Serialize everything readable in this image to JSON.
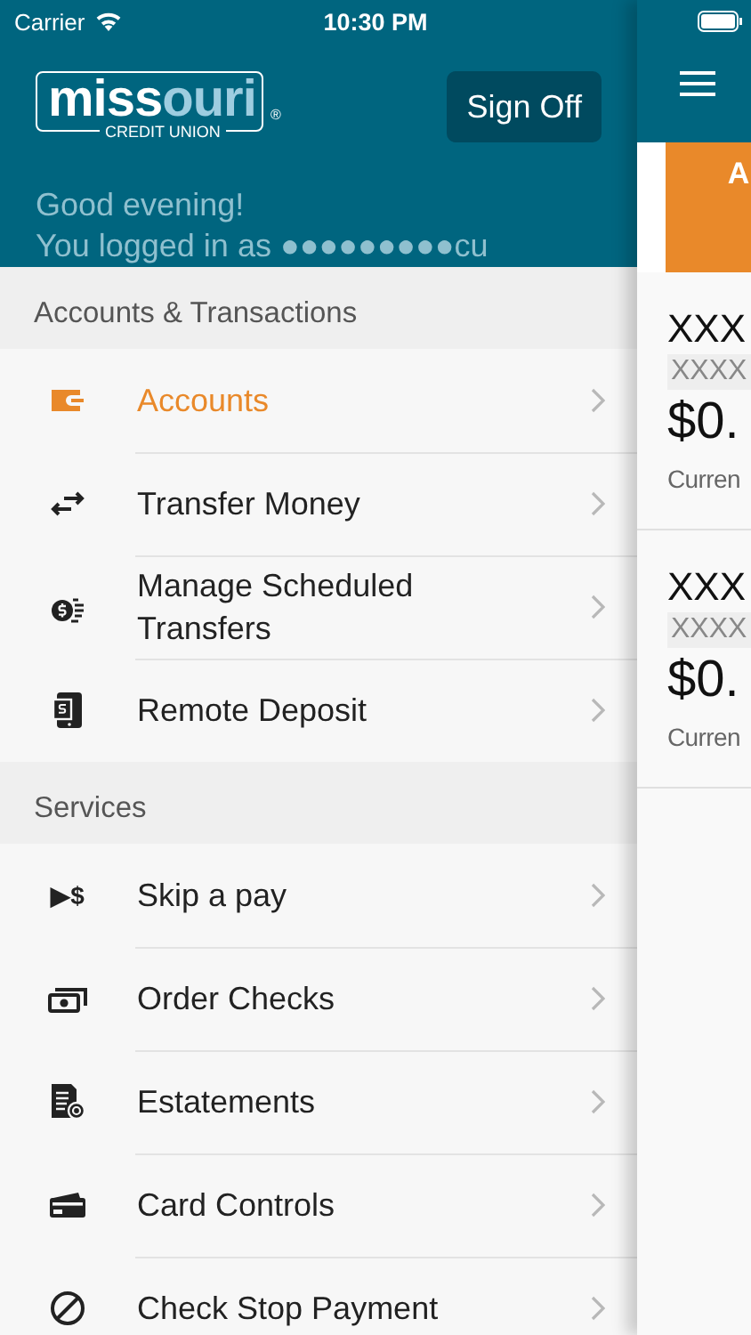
{
  "status_bar": {
    "carrier": "Carrier",
    "time": "10:30 PM"
  },
  "header": {
    "logo": {
      "main": "miss",
      "accent": "ouri",
      "subtitle": "CREDIT UNION",
      "mark": "®"
    },
    "sign_off": "Sign Off",
    "greeting": "Good evening!",
    "login": "You logged in as ●●●●●●●●●cu"
  },
  "sections": [
    {
      "title": "Accounts & Transactions",
      "items": [
        {
          "label": "Accounts",
          "kind": "wallet",
          "selected": true
        },
        {
          "label": "Transfer Money",
          "kind": "arrows",
          "selected": false
        },
        {
          "label": "Manage Scheduled Transfers",
          "kind": "coin",
          "selected": false
        },
        {
          "label": "Remote Deposit",
          "kind": "phone",
          "selected": false
        }
      ]
    },
    {
      "title": "Services",
      "items": [
        {
          "label": "Skip a pay",
          "kind": "glyph",
          "glyph": "▶$",
          "selected": false
        },
        {
          "label": "Order Checks",
          "kind": "cash",
          "selected": false
        },
        {
          "label": "Estatements",
          "kind": "statement",
          "selected": false
        },
        {
          "label": "Card Controls",
          "kind": "card",
          "selected": false
        },
        {
          "label": "Check Stop Payment",
          "kind": "stop",
          "selected": false
        }
      ]
    }
  ],
  "behind": {
    "tab": "A",
    "accounts": [
      {
        "name": "XXX",
        "number": "XXXX",
        "balance": "$0.",
        "type": "Curren"
      },
      {
        "name": "XXX",
        "number": "XXXX",
        "balance": "$0.",
        "type": "Curren"
      }
    ]
  }
}
